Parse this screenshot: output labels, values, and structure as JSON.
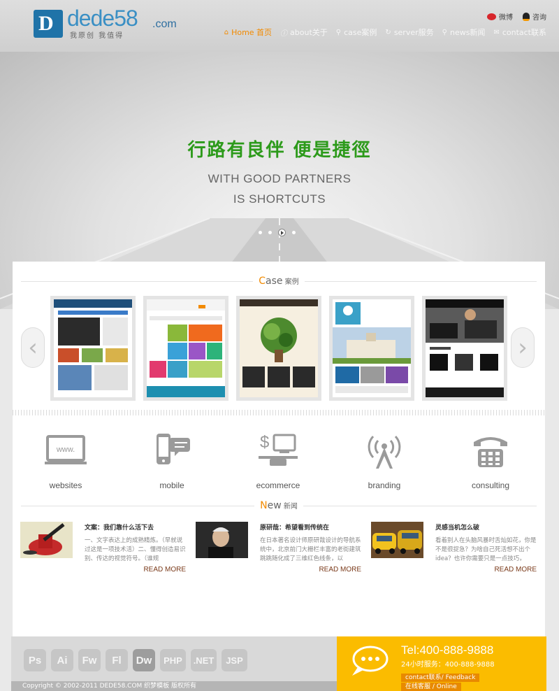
{
  "header": {
    "logo_name": "dede58",
    "logo_domain": ".com",
    "logo_slogan": "我原创 我值得",
    "top_links": [
      {
        "label": "微博",
        "icon": "weibo-icon"
      },
      {
        "label": "咨询",
        "icon": "qq-icon"
      }
    ],
    "nav": [
      {
        "label": "Home 首页",
        "icon": "home-icon",
        "active": true
      },
      {
        "label": "about关于",
        "icon": "info-icon",
        "active": false
      },
      {
        "label": "case案例",
        "icon": "link-icon",
        "active": false
      },
      {
        "label": "server服务",
        "icon": "refresh-icon",
        "active": false
      },
      {
        "label": "news新闻",
        "icon": "search-icon",
        "active": false
      },
      {
        "label": "contact联系",
        "icon": "mail-icon",
        "active": false
      }
    ]
  },
  "banner": {
    "headline_cn": "行路有良伴  便是捷徑",
    "headline_en_1": "WITH GOOD PARTNERS",
    "headline_en_2": "IS SHORTCUTS",
    "slide_count": 4,
    "active_slide": 3
  },
  "cases": {
    "title_accent": "C",
    "title_rest": "ase",
    "title_cn": "案例",
    "items": [
      "case-site-1",
      "case-site-2",
      "case-site-3",
      "case-site-4",
      "case-site-5"
    ]
  },
  "services": [
    {
      "label": "websites",
      "icon": "monitor-icon"
    },
    {
      "label": "mobile",
      "icon": "mobile-icon"
    },
    {
      "label": "ecommerce",
      "icon": "ecommerce-icon"
    },
    {
      "label": "branding",
      "icon": "antenna-icon"
    },
    {
      "label": "consulting",
      "icon": "phone-icon"
    }
  ],
  "news": {
    "title_accent": "N",
    "title_rest": "ew",
    "title_cn": "新闻",
    "items": [
      {
        "title": "文案：我们靠什么活下去",
        "desc": "一、文字表达上的成熟精炼。（早就说过这是一项技术活）二、懂得创造易识别、传达的视觉符号。（谁规",
        "more": "READ MORE"
      },
      {
        "title": "原研哉：希望看到传统在",
        "desc": "在日本著名设计师原研哉设计的导航系统中，北京前门大栅栏丰富的老街建筑跳跳随化成了三维红色线条，以",
        "more": "READ MORE"
      },
      {
        "title": "灵感当机怎么破",
        "desc": "看着别人在头脑风暴时舌灿如花，你是不是很捉急？为啥自己死活想不出个idea？也许你需要只是一点技巧，",
        "more": "READ MORE"
      }
    ]
  },
  "footer": {
    "tools": [
      "Ps",
      "Ai",
      "Fw",
      "Fl",
      "Dw",
      "PHP",
      ".NET",
      "JSP"
    ],
    "copyright": "Copyright © 2002-2011 DEDE58.COM 织梦模板 版权所有",
    "tel": "Tel:400-888-9888",
    "hours": "24小时服务：400-888-9888",
    "feedback_btn": "contact联系/ Feedback",
    "online_btn": "在线客服 / Online"
  }
}
